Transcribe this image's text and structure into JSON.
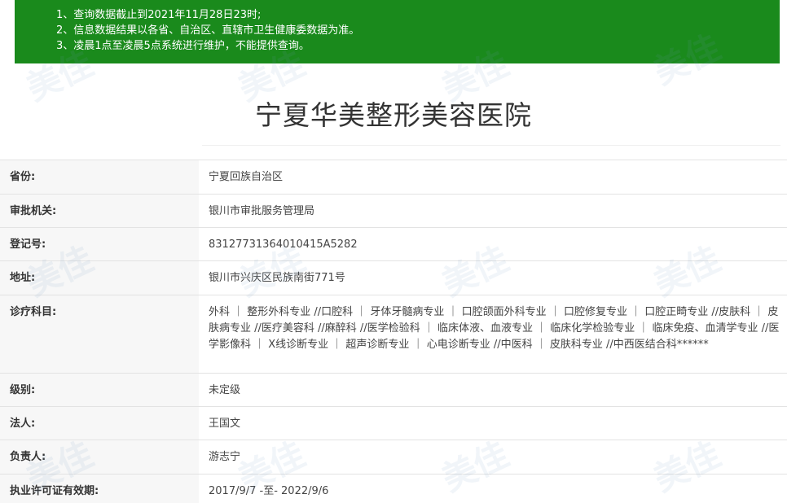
{
  "notice": {
    "lines": [
      "1、查询数据截止到2021年11月28日23时;",
      "2、信息数据结果以各省、自治区、直辖市卫生健康委数据为准。",
      "3、凌晨1点至凌晨5点系统进行维护，不能提供查询。"
    ]
  },
  "hospital": {
    "name": "宁夏华美整形美容医院"
  },
  "fields": [
    {
      "label": "省份:",
      "value": "宁夏回族自治区"
    },
    {
      "label": "审批机关:",
      "value": "银川市审批服务管理局"
    },
    {
      "label": "登记号:",
      "value": "83127731364010415A5282"
    },
    {
      "label": "地址:",
      "value": "银川市兴庆区民族南街771号"
    },
    {
      "label": "诊疗科目:",
      "value": "外科 ｜ 整形外科专业 //口腔科 ｜ 牙体牙髓病专业 ｜ 口腔颌面外科专业 ｜ 口腔修复专业 ｜ 口腔正畸专业 //皮肤科 ｜ 皮肤病专业 //医疗美容科 //麻醉科 //医学检验科 ｜ 临床体液、血液专业 ｜ 临床化学检验专业 ｜ 临床免疫、血清学专业 //医学影像科 ｜ X线诊断专业 ｜ 超声诊断专业 ｜ 心电诊断专业 //中医科 ｜ 皮肤科专业 //中西医结合科******"
    },
    {
      "label": "级别:",
      "value": "未定级"
    },
    {
      "label": "法人:",
      "value": "王国文"
    },
    {
      "label": "负责人:",
      "value": "游志宁"
    },
    {
      "label": "执业许可证有效期:",
      "value": "2017/9/7 -至- 2022/9/6"
    }
  ],
  "watermark": {
    "text": "美佳"
  }
}
